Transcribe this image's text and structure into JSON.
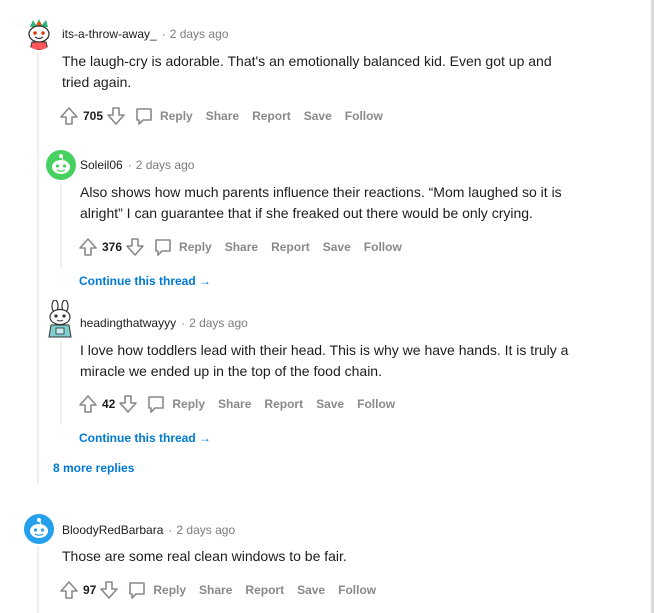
{
  "comments": [
    {
      "username": "its-a-throw-away_",
      "time": "2 days ago",
      "body": "The laugh-cry is adorable. That's an emotionally balanced kid. Even got up and tried again.",
      "score": "705",
      "actions": {
        "reply": "Reply",
        "share": "Share",
        "report": "Report",
        "save": "Save",
        "follow": "Follow"
      },
      "avatar_icon": "green-hair-snoo-avatar"
    },
    {
      "username": "Soleil06",
      "time": "2 days ago",
      "body": "Also shows how much parents influence their reactions. “Mom laughed so it is alright” I can guarantee that if she freaked out there would be only crying.",
      "score": "376",
      "actions": {
        "reply": "Reply",
        "share": "Share",
        "report": "Report",
        "save": "Save",
        "follow": "Follow"
      },
      "avatar_icon": "green-snoo-avatar",
      "continue_thread": "Continue this thread"
    },
    {
      "username": "headingthatwayyy",
      "time": "2 days ago",
      "body": "I love how toddlers lead with their head. This is why we have hands. It is truly a miracle we ended up in the top of the food chain.",
      "score": "42",
      "actions": {
        "reply": "Reply",
        "share": "Share",
        "report": "Report",
        "save": "Save",
        "follow": "Follow"
      },
      "avatar_icon": "bunny-ears-snoo-avatar",
      "continue_thread": "Continue this thread"
    },
    {
      "username": "BloodyRedBarbara",
      "time": "2 days ago",
      "body": "Those are some real clean windows to be fair.",
      "score": "97",
      "actions": {
        "reply": "Reply",
        "share": "Share",
        "report": "Report",
        "save": "Save",
        "follow": "Follow"
      },
      "avatar_icon": "blue-snoo-avatar"
    }
  ],
  "more_replies": "8 more replies",
  "colors": {
    "link": "#0079d3",
    "meta": "#7c7c7c",
    "action": "#878a8c",
    "thread_line": "#edeff1"
  }
}
